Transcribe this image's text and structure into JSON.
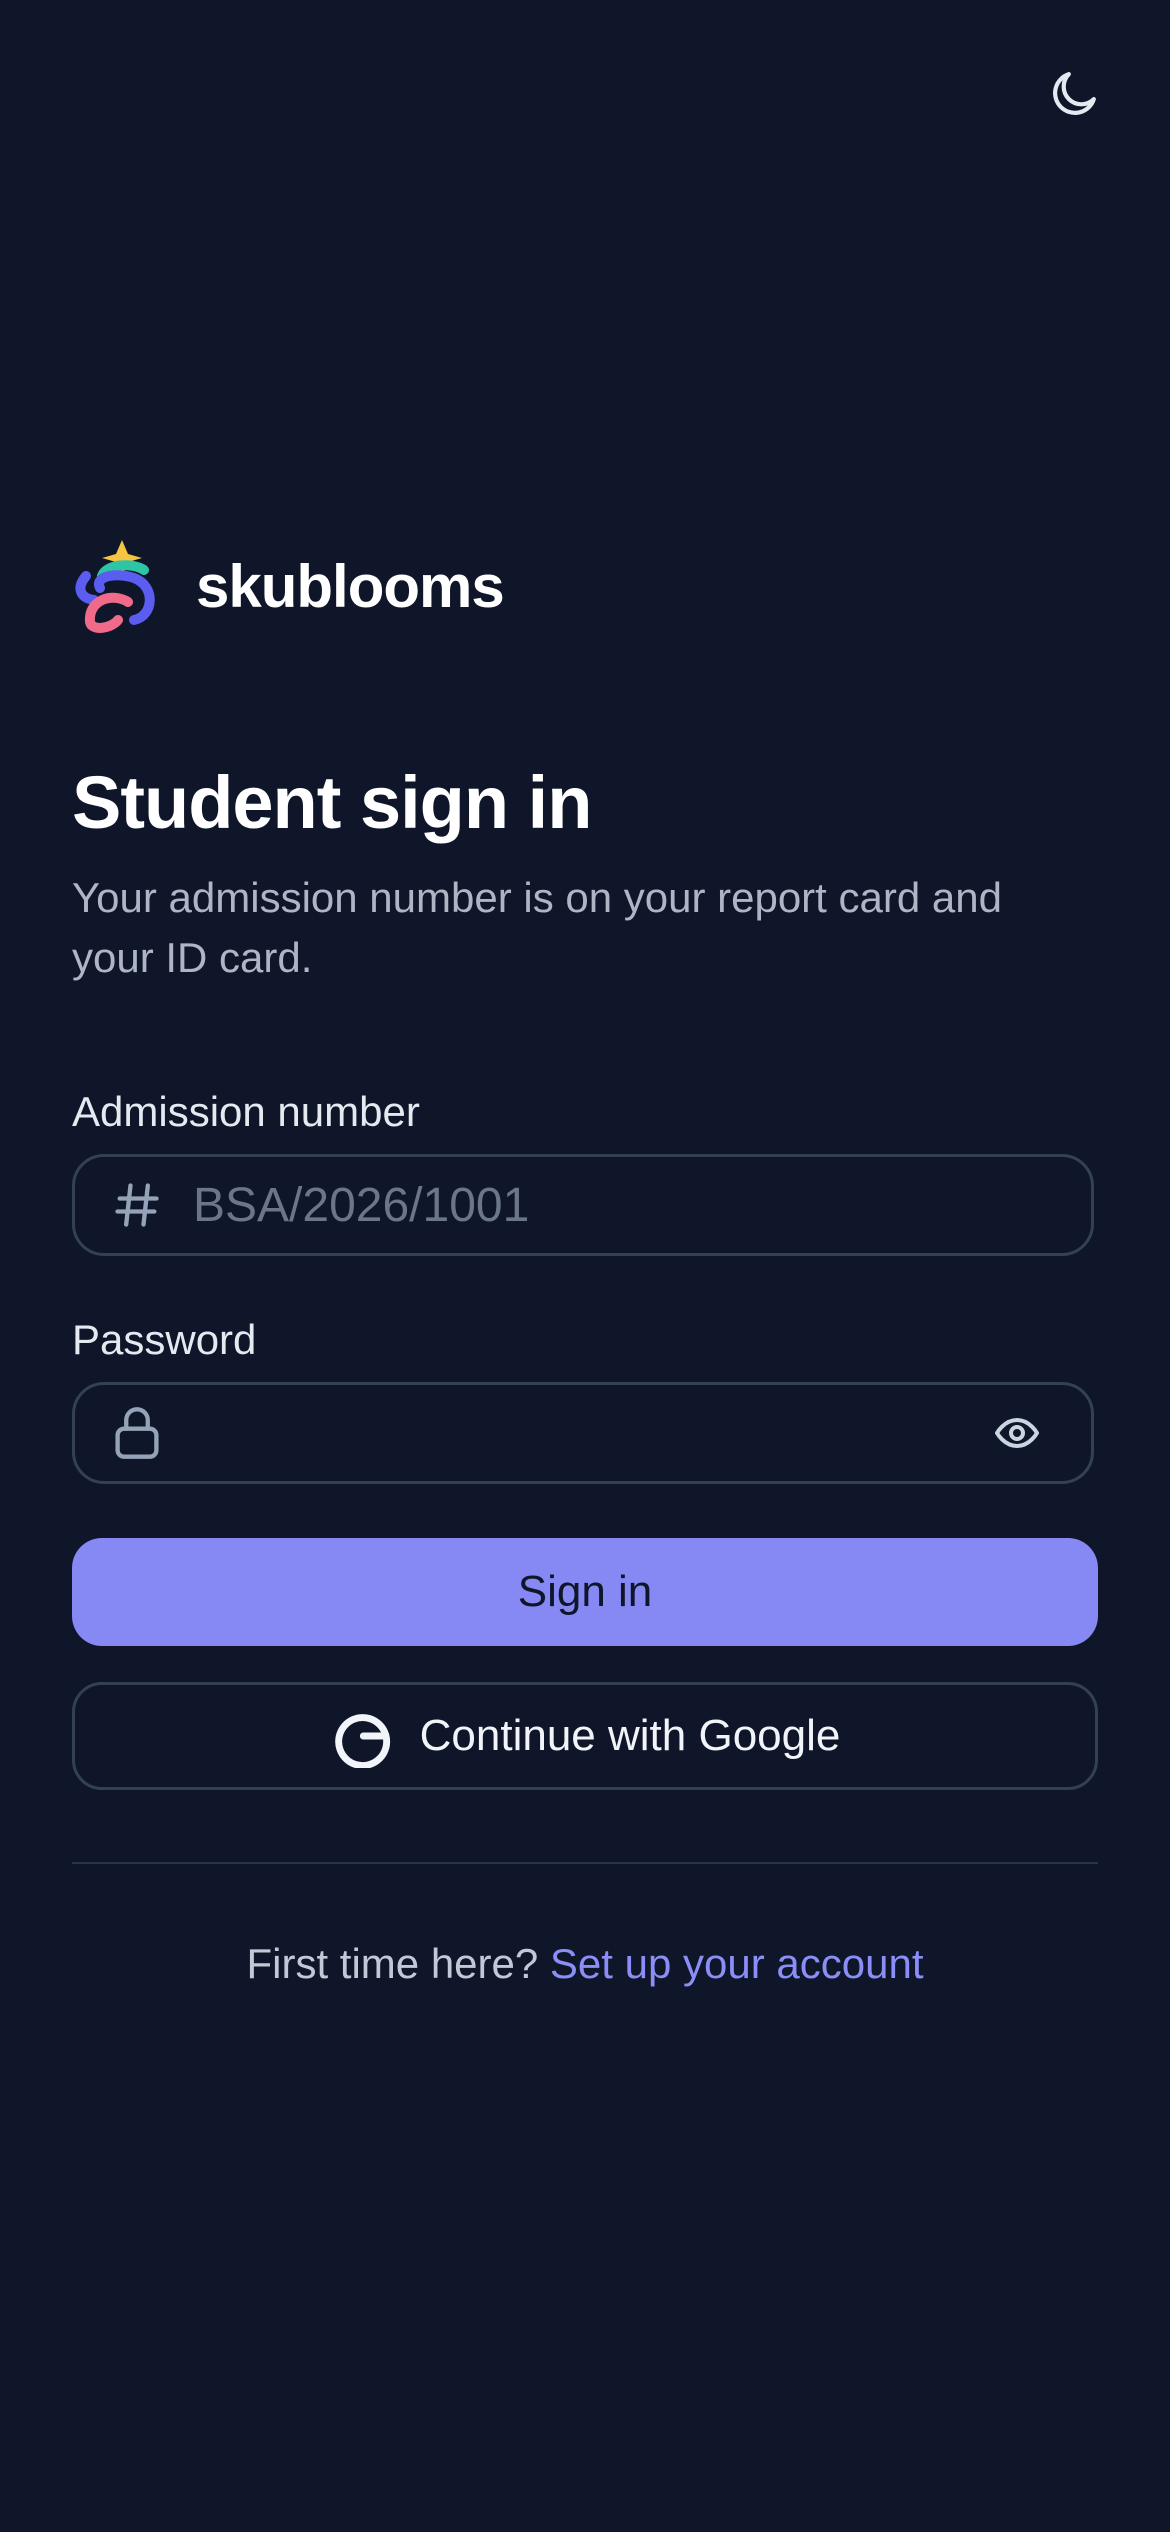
{
  "header": {
    "theme_toggle_icon": "moon-icon"
  },
  "brand": {
    "logo_icon": "skublooms-logo",
    "name": "skublooms",
    "logo_colors": {
      "star": "#f5c542",
      "teal": "#2ec4a6",
      "indigo": "#5b5cf0",
      "pink": "#f06a8a"
    }
  },
  "page": {
    "title": "Student sign in",
    "subtitle": "Your admission number is on your report card and your ID card."
  },
  "form": {
    "admission": {
      "label": "Admission number",
      "placeholder": "BSA/2026/1001",
      "value": "",
      "icon": "hash-icon"
    },
    "password": {
      "label": "Password",
      "value": "",
      "icon": "lock-icon",
      "toggle_icon": "eye-icon"
    },
    "sign_in_label": "Sign in",
    "google_label": "Continue with Google",
    "google_icon": "google-g-icon"
  },
  "footer": {
    "prompt": "First time here?",
    "link": "Set up your account"
  },
  "colors": {
    "background": "#0f1629",
    "accent": "#8688f4",
    "link": "#8b8ef7",
    "border": "#334155"
  }
}
